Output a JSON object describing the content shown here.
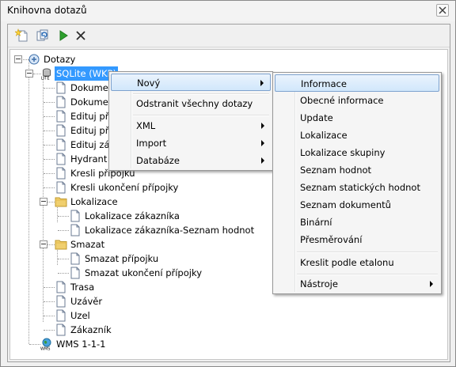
{
  "window": {
    "title": "Knihovna dotazů"
  },
  "toolbar": {
    "buttons": [
      "new-query-icon",
      "refresh-icon",
      "run-icon",
      "delete-icon"
    ]
  },
  "tree": {
    "root": "Dotazy",
    "sqlite": "SQLite (WKP)",
    "items": [
      "Dokument",
      "Dokument",
      "Edituj příp",
      "Edituj příp",
      "Edituj zák",
      "Hydrant",
      "Kresli přípojku",
      "Kresli ukončení přípojky"
    ],
    "folder_lokalizace": "Lokalizace",
    "lokalizace_items": [
      "Lokalizace zákazníka",
      "Lokalizace zákazníka-Seznam hodnot"
    ],
    "folder_smazat": "Smazat",
    "smazat_items": [
      "Smazat přípojku",
      "Smazat ukončení přípojky"
    ],
    "tail_items": [
      "Trasa",
      "Uzávěr",
      "Uzel",
      "Zákazník"
    ],
    "wms": "WMS 1-1-1"
  },
  "context_menu": {
    "items": [
      "Nový",
      "Odstranit všechny dotazy",
      "XML",
      "Import",
      "Databáze"
    ],
    "highlighted": "Nový"
  },
  "submenu": {
    "items": [
      "Informace",
      "Obecné informace",
      "Update",
      "Lokalizace",
      "Lokalizace skupiny",
      "Seznam hodnot",
      "Seznam statických hodnot",
      "Seznam dokumentů",
      "Binární",
      "Přesměrování",
      "Kreslit podle etalonu",
      "Nástroje"
    ],
    "highlighted": "Informace"
  },
  "colors": {
    "selection": "#3399ff",
    "menu_highlight_border": "#7da2ce",
    "folder": "#f0cf6e"
  }
}
